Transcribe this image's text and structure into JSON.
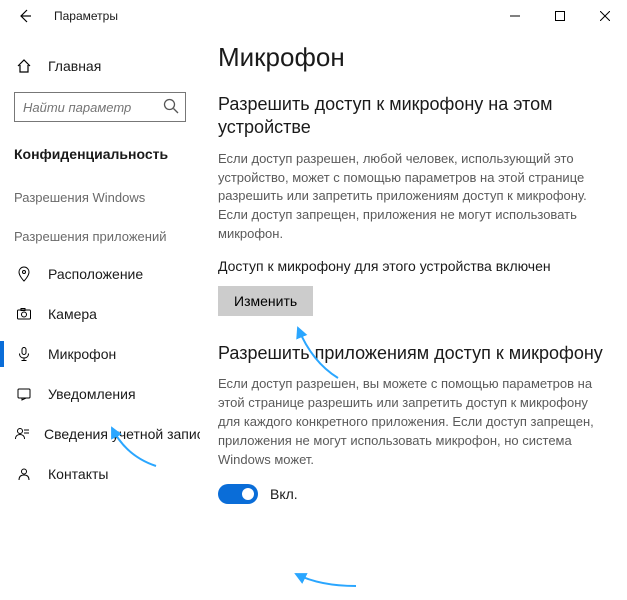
{
  "titlebar": {
    "title": "Параметры"
  },
  "sidebar": {
    "home": "Главная",
    "search_placeholder": "Найти параметр",
    "section": "Конфиденциальность",
    "group1": "Разрешения Windows",
    "group2": "Разрешения приложений",
    "items": [
      {
        "label": "Расположение"
      },
      {
        "label": "Камера"
      },
      {
        "label": "Микрофон"
      },
      {
        "label": "Уведомления"
      },
      {
        "label": "Сведения учетной записи"
      },
      {
        "label": "Контакты"
      }
    ]
  },
  "content": {
    "page_title": "Микрофон",
    "sec1_title": "Разрешить доступ к микрофону на этом устройстве",
    "sec1_desc": "Если доступ разрешен, любой человек, использующий это устройство, может с помощью параметров на этой странице разрешить или запретить приложениям доступ к микрофону. Если доступ запрещен, приложения не могут использовать микрофон.",
    "status": "Доступ к микрофону для этого устройства включен",
    "change_btn": "Изменить",
    "sec2_title": "Разрешить приложениям доступ к микрофону",
    "sec2_desc": "Если доступ разрешен, вы можете с помощью параметров на этой странице разрешить или запретить доступ к микрофону для каждого конкретного приложения. Если доступ запрещен, приложения не могут использовать микрофон, но система Windows может.",
    "toggle_label": "Вкл."
  }
}
